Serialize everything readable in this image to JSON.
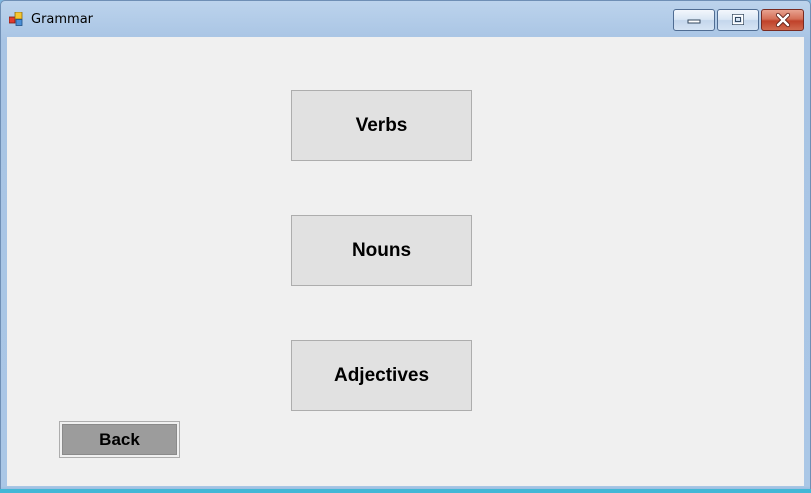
{
  "window": {
    "title": "Grammar",
    "icon": "app-window-icon",
    "controls": {
      "minimize_icon": "minimize-icon",
      "maximize_icon": "maximize-icon",
      "close_icon": "close-icon"
    }
  },
  "main": {
    "buttons": {
      "verbs": "Verbs",
      "nouns": "Nouns",
      "adjectives": "Adjectives"
    },
    "back_label": "Back"
  },
  "colors": {
    "client_background": "#f0f0f0",
    "button_face": "#e1e1e1",
    "back_button_face": "#9c9c9c",
    "close_button": "#c0412a"
  }
}
